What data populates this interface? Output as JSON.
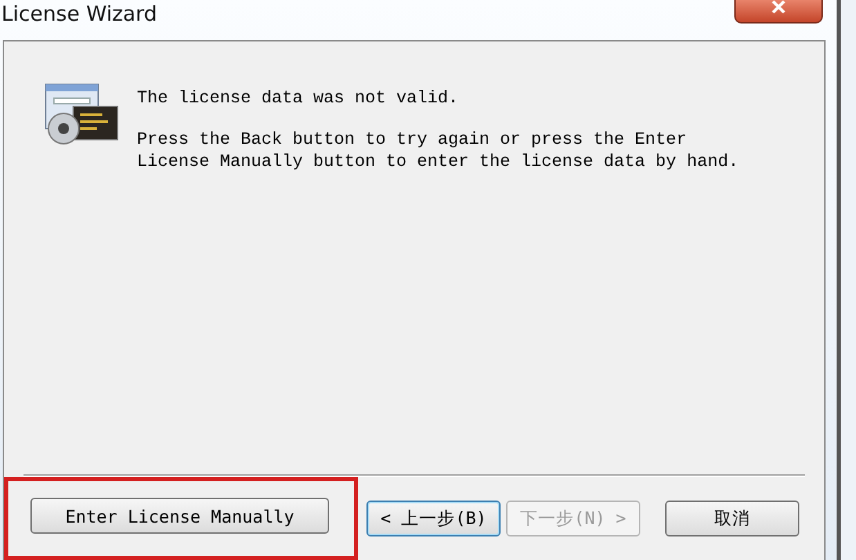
{
  "window": {
    "title": "License Wizard"
  },
  "message": {
    "headline": "The license data was not valid.",
    "body": "Press the Back button to try again or press the Enter License Manually button to enter the license data by hand."
  },
  "buttons": [
    {
      "label": "Enter License Manually",
      "kind": "action",
      "disabled": false,
      "focused": false,
      "highlighted": true
    },
    {
      "label": "< 上一步(B)",
      "kind": "nav",
      "disabled": false,
      "focused": true,
      "highlighted": false
    },
    {
      "label": "下一步(N) >",
      "kind": "nav",
      "disabled": true,
      "focused": false,
      "highlighted": false
    },
    {
      "label": "取消",
      "kind": "cancel",
      "disabled": false,
      "focused": false,
      "highlighted": false
    }
  ]
}
